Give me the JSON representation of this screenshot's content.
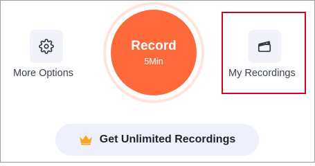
{
  "more_options": {
    "label": "More Options",
    "icon": "gear-icon"
  },
  "record": {
    "title": "Record",
    "subtitle": "5Min",
    "color": "#ff6a3d"
  },
  "my_recordings": {
    "label": "My Recordings",
    "icon": "clapperboard-icon"
  },
  "promo": {
    "label": "Get Unlimited Recordings",
    "icon": "crown-icon",
    "icon_color": "#f5a623"
  },
  "highlight_color": "#d0021b"
}
